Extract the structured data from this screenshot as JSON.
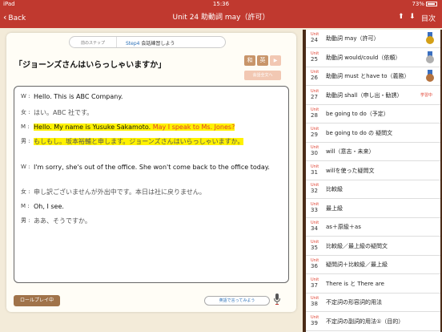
{
  "status": {
    "device": "iPad",
    "time": "15:36",
    "battery": "73%"
  },
  "nav": {
    "back": "Back",
    "title": "Unit 24  助動詞 may（許可）",
    "index": "目次"
  },
  "steps": {
    "prev": "前のステップ",
    "current_step": "Step4",
    "current_label": "会話練習しよう"
  },
  "question": "「ジョーンズさんはいらっしゃいますか」",
  "buttons": {
    "jp": "和",
    "en": "英",
    "play": "▶",
    "play_all": "会話全文へ",
    "roleplay": "ロールプレイ中",
    "say": "英語で言ってみよう"
  },
  "dialog": [
    {
      "speaker": "W :",
      "lang": "en",
      "text": "Hello. This is ABC Company."
    },
    {
      "speaker": "女 :",
      "lang": "ja",
      "text": "はい。ABC 社です。"
    },
    {
      "speaker": "M :",
      "lang": "en",
      "text": "Hello. My name is Yusuke Sakamoto.",
      "text2": "May I speak to Ms. Jones?"
    },
    {
      "speaker": "男 :",
      "lang": "ja",
      "text": "もしもし。坂本裕輔と申します。ジョーンズさんはいらっしゃいますか。"
    },
    {
      "speaker": "W :",
      "lang": "en",
      "text": "I'm sorry, she's out of the office. She won't come back to the office today."
    },
    {
      "speaker": "女 :",
      "lang": "ja",
      "text": "申し訳ございませんが外出中です。本日は社に戻りません。"
    },
    {
      "speaker": "M :",
      "lang": "en",
      "text": "Oh, I see."
    },
    {
      "speaker": "男 :",
      "lang": "ja",
      "text": "ああ、そうですか。"
    }
  ],
  "units": [
    {
      "unit": "Unit",
      "num": "24",
      "label": "助動詞 may（許可）",
      "medal": "gold"
    },
    {
      "unit": "Unit",
      "num": "25",
      "label": "助動詞 would/could（依頼）",
      "medal": "silver"
    },
    {
      "unit": "Unit",
      "num": "26",
      "label": "助動詞 must とhave to（義務）",
      "medal": "bronze"
    },
    {
      "unit": "Unit",
      "num": "27",
      "label": "助動詞 shall（申し出・勧誘）",
      "tag": "学習中"
    },
    {
      "unit": "Unit",
      "num": "28",
      "label": "be going to do（予定）"
    },
    {
      "unit": "Unit",
      "num": "29",
      "label": "be going to do の 疑問文"
    },
    {
      "unit": "Unit",
      "num": "30",
      "label": "will（意志・未来）"
    },
    {
      "unit": "Unit",
      "num": "31",
      "label": "willを使った疑問文"
    },
    {
      "unit": "Unit",
      "num": "32",
      "label": "比較級"
    },
    {
      "unit": "Unit",
      "num": "33",
      "label": "最上級"
    },
    {
      "unit": "Unit",
      "num": "34",
      "label": "as＋原級＋as"
    },
    {
      "unit": "Unit",
      "num": "35",
      "label": "比較級／最上級の疑問文"
    },
    {
      "unit": "Unit",
      "num": "36",
      "label": "疑問詞＋比較級／最上級"
    },
    {
      "unit": "Unit",
      "num": "37",
      "label": "There is と There are"
    },
    {
      "unit": "Unit",
      "num": "38",
      "label": "不定詞の形容詞的用法"
    },
    {
      "unit": "Unit",
      "num": "39",
      "label": "不定詞の副詞的用法①（目的）"
    }
  ],
  "colors": {
    "brand": "#c0392f",
    "medal_gold": "#d4a017",
    "medal_silver": "#b0b0b0",
    "medal_bronze": "#b5733f"
  }
}
